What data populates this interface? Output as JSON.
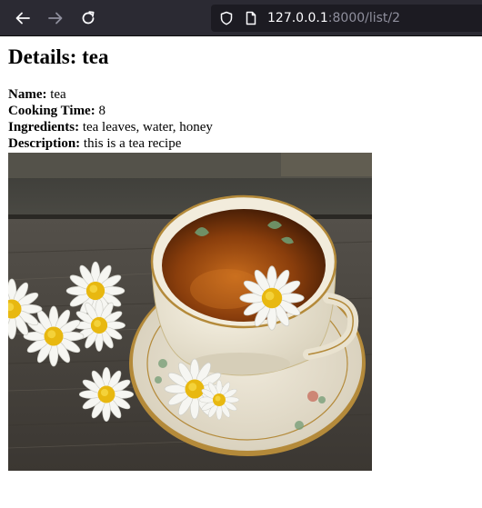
{
  "browser": {
    "url_host": "127.0.0.1",
    "url_rest": ":8000/list/2"
  },
  "page": {
    "title": "Details: tea",
    "fields": [
      {
        "label": "Name:",
        "value": "tea"
      },
      {
        "label": "Cooking Time:",
        "value": "8"
      },
      {
        "label": "Ingredients:",
        "value": "tea leaves, water, honey"
      },
      {
        "label": "Description:",
        "value": "this is a tea recipe"
      }
    ]
  },
  "icons": {
    "back": "arrow-left-icon",
    "forward": "arrow-right-icon",
    "reload": "reload-icon",
    "tracking": "shield-icon",
    "page": "page-icon"
  },
  "colors": {
    "toolbar_bg": "#2b2a33",
    "urlbar_bg": "#1c1b22",
    "url_host": "#fbfbfe",
    "url_rest": "#8f8f9d"
  }
}
